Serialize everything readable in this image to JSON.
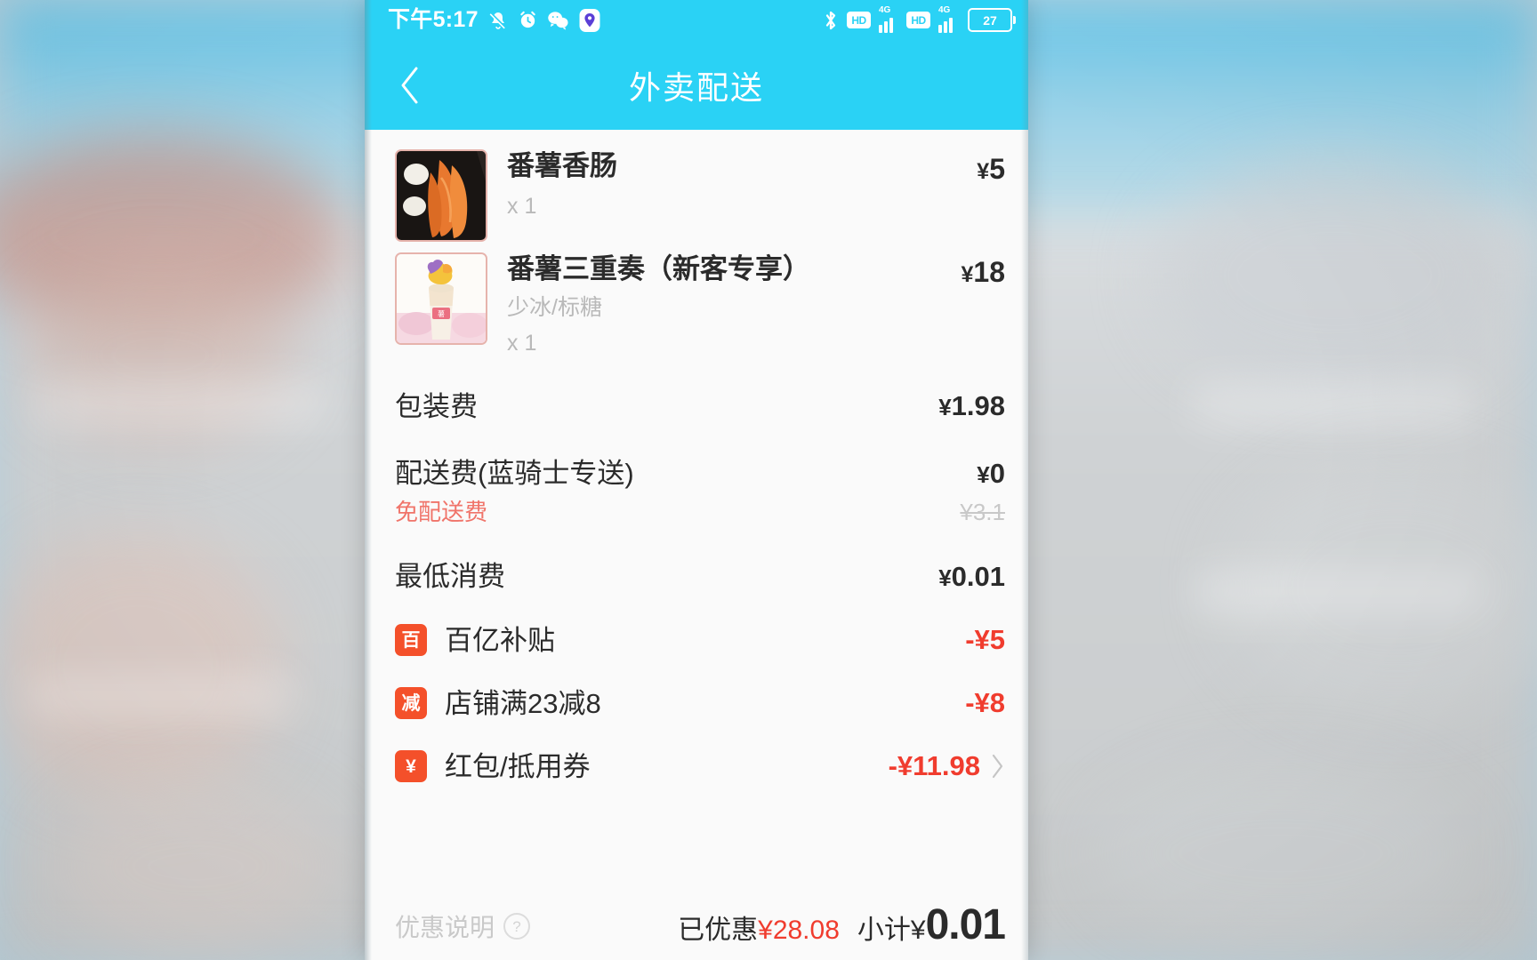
{
  "statusbar": {
    "time": "下午5:17",
    "left_icons": [
      "silent-icon",
      "alarm-icon",
      "wechat-icon",
      "location-icon"
    ],
    "right_icons": [
      "bluetooth-icon",
      "hd-icon",
      "signal-icon",
      "hd-icon",
      "signal-icon"
    ],
    "hd_label": "HD",
    "network_label": "4G",
    "battery_level": "27"
  },
  "navbar": {
    "back_icon": "chevron-left-icon",
    "title": "外卖配送"
  },
  "products": [
    {
      "name": "番薯香肠",
      "spec": "",
      "qty": "x 1",
      "currency": "¥",
      "price": "5",
      "thumb": "sweet-potato-sausage-photo"
    },
    {
      "name": "番薯三重奏（新客专享）",
      "spec": "少冰/标糖",
      "qty": "x 1",
      "currency": "¥",
      "price": "18",
      "thumb": "sweet-potato-drink-photo"
    }
  ],
  "fees": [
    {
      "label": "包装费",
      "currency": "¥",
      "value": "1.98"
    },
    {
      "label": "配送费(蓝骑士专送)",
      "currency": "¥",
      "value": "0",
      "sub_tag": "免配送费",
      "sub_old": "¥3.1"
    },
    {
      "label": "最低消费",
      "currency": "¥",
      "value": "0.01"
    }
  ],
  "discounts": [
    {
      "icon_char": "百",
      "icon_name": "baiyi-subsidy-icon",
      "label": "百亿补贴",
      "value": "-¥5",
      "chevron": false
    },
    {
      "icon_char": "减",
      "icon_name": "shop-discount-icon",
      "label": "店铺满23减8",
      "value": "-¥8",
      "chevron": false
    },
    {
      "icon_char": "¥",
      "icon_name": "coupon-icon",
      "label": "红包/抵用券",
      "value": "-¥11.98",
      "chevron": true
    }
  ],
  "summary": {
    "note_label": "优惠说明",
    "note_icon": "question-circle-icon",
    "saved_label": "已优惠",
    "saved_currency": "¥",
    "saved_amount": "28.08",
    "total_label": "小计",
    "total_currency": "¥",
    "total_amount": "0.01"
  },
  "colors": {
    "brand": "#2ad2f5",
    "accent_red": "#f03c2e",
    "icon_orange": "#f4502a",
    "page_bg": "#fafafa"
  }
}
